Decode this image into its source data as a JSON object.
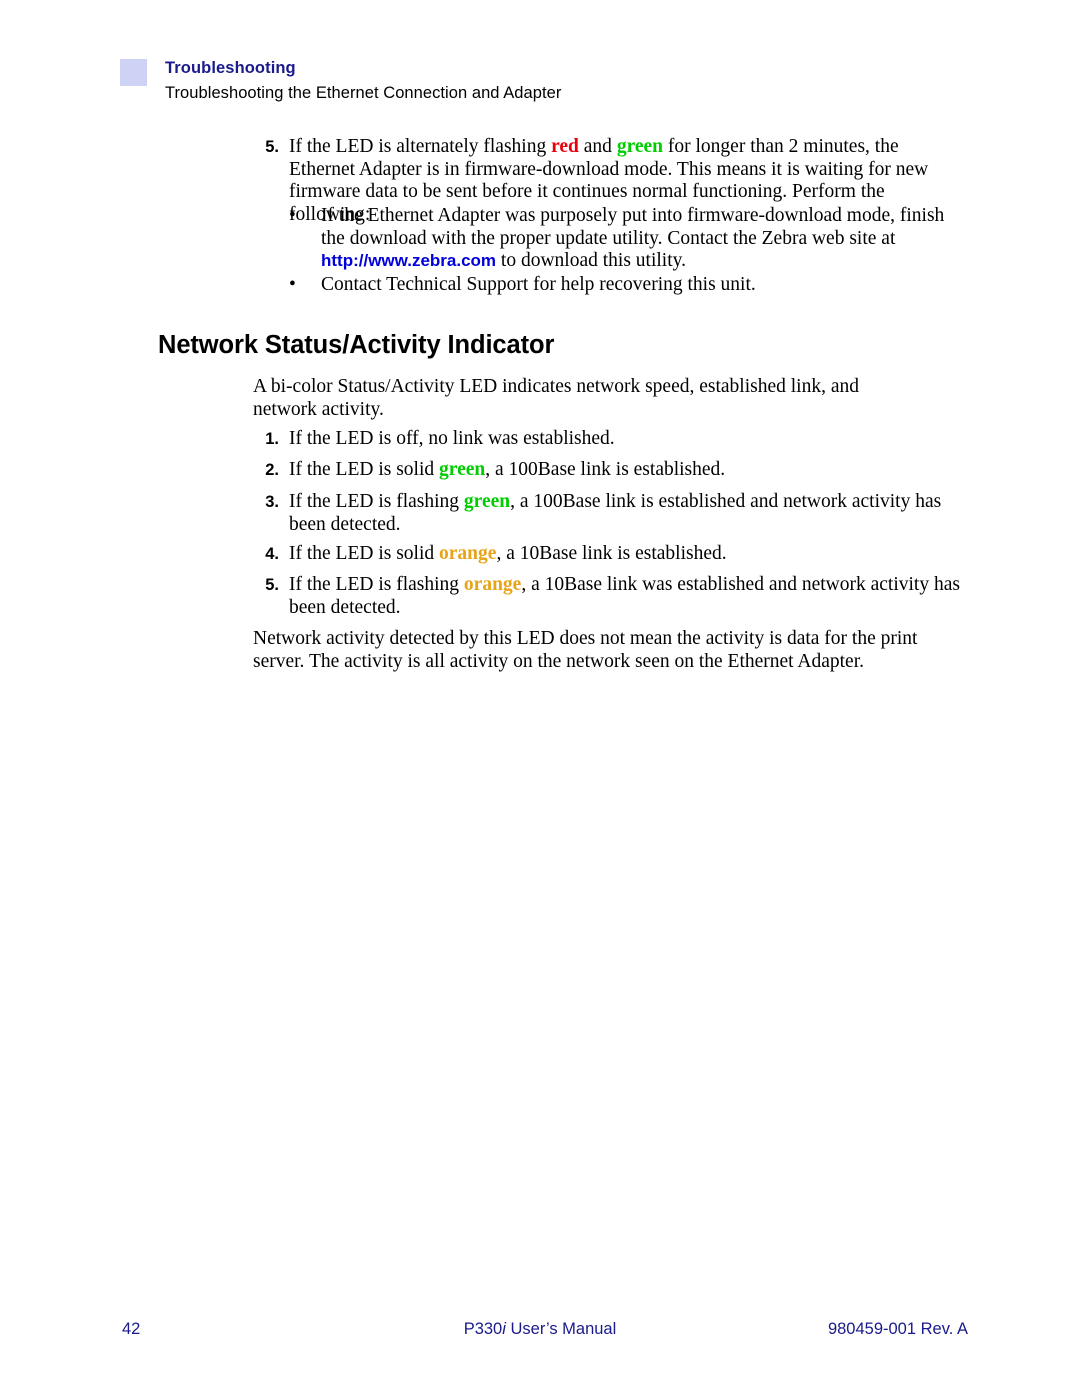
{
  "header": {
    "title": "Troubleshooting",
    "subtitle": "Troubleshooting the Ethernet Connection and Adapter",
    "swatch_color": "#ced2f4",
    "title_color": "#1a1a8c"
  },
  "colors": {
    "red": "#e8000d",
    "green": "#00cc00",
    "orange": "#e8a317",
    "link_blue": "#0000dd",
    "footer_blue": "#1a1a8c"
  },
  "top_list": {
    "number": "5.",
    "text_a": "If the LED is alternately flashing ",
    "word_red": "red",
    "text_b": " and ",
    "word_green": "green",
    "text_c": " for longer than 2 minutes, the Ethernet Adapter is in firmware-download mode. This means it is waiting for new firmware data to be sent before it continues normal functioning. Perform the following:"
  },
  "bullets": [
    {
      "marker": "•",
      "text_a": "If the Ethernet Adapter was purposely put into firmware-download mode, finish the download with the proper update utility. Contact the Zebra web site at ",
      "url": "http://www.zebra.com",
      "text_b": " to download this utility."
    },
    {
      "marker": "•",
      "text_a": "Contact Technical Support for help recovering this unit.",
      "url": "",
      "text_b": ""
    }
  ],
  "section": {
    "heading": "Network Status/Activity Indicator",
    "intro": "A bi-color Status/Activity LED indicates network speed, established link, and network activity.",
    "items": [
      {
        "number": "1.",
        "text_a": "If the LED is off, no link was established.",
        "color_word": "",
        "color_class": "",
        "text_b": ""
      },
      {
        "number": "2.",
        "text_a": "If the LED is solid ",
        "color_word": "green",
        "color_class": "c-green",
        "text_b": ", a 100Base link is established."
      },
      {
        "number": "3.",
        "text_a": "If the LED is flashing ",
        "color_word": "green",
        "color_class": "c-green",
        "text_b": ", a 100Base link is established and network activity has been detected."
      },
      {
        "number": "4.",
        "text_a": "If the LED is solid ",
        "color_word": "orange",
        "color_class": "c-orange",
        "text_b": ", a 10Base link is established."
      },
      {
        "number": "5.",
        "text_a": "If the LED is flashing ",
        "color_word": "orange",
        "color_class": "c-orange",
        "text_b": ", a 10Base link was established and network activity has been detected."
      }
    ],
    "closing": "Network activity detected by this LED does not mean the activity is data for the print server. The activity is all activity on the network seen on the Ethernet Adapter."
  },
  "footer": {
    "page_number": "42",
    "manual_prefix": "P330",
    "manual_italic": "i",
    "manual_suffix": " User’s Manual",
    "doc_id": "980459-001 Rev. A"
  }
}
